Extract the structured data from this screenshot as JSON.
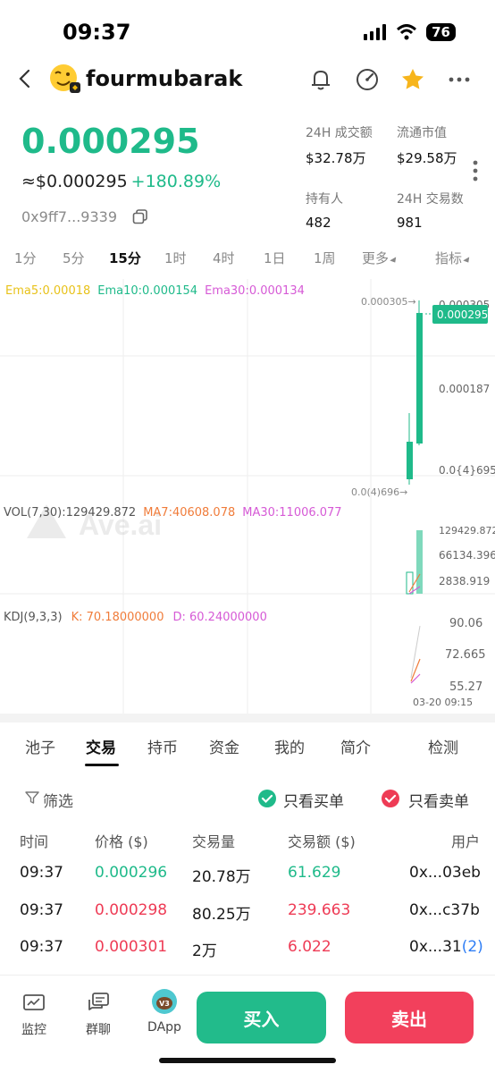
{
  "status": {
    "time": "09:37",
    "battery": "76"
  },
  "header": {
    "token_name": "fourmubarak"
  },
  "price": {
    "main": "0.000295",
    "usd": "≈$0.000295",
    "change": "+180.89%",
    "address": "0x9ff7...9339"
  },
  "stats": [
    {
      "label": "24H 成交额",
      "value": "$32.78万"
    },
    {
      "label": "流通市值",
      "value": "$29.58万"
    },
    {
      "label": "持有人",
      "value": "482"
    },
    {
      "label": "24H 交易数",
      "value": "981"
    }
  ],
  "timeframes": [
    "1分",
    "5分",
    "15分",
    "1时",
    "4时",
    "1日",
    "1周",
    "更多",
    "指标"
  ],
  "chart": {
    "ema5": "Ema5:0.00018",
    "ema10": "Ema10:0.000154",
    "ema30": "Ema30:0.000134",
    "high_label": "0.000305→",
    "low_label": "0.0(4)696→",
    "current_price": "0.000295",
    "y_ticks": [
      "0.000305",
      "0.000187",
      "0.0{4}695"
    ],
    "vol_line": "VOL(7,30):129429.872",
    "vol_ma7": "MA7:40608.078",
    "vol_ma30": "MA30:11006.077",
    "vol_ticks": [
      "129429.872",
      "66134.396",
      "2838.919"
    ],
    "kdj_line": "KDJ(9,3,3)",
    "kdj_k": "K: 70.18000000",
    "kdj_d": "D: 60.24000000",
    "kdj_ticks": [
      "90.06",
      "72.665",
      "55.27"
    ],
    "time_label": "03-20 09:15",
    "watermark": "Ave.ai",
    "colors": {
      "ema5": "#e8c21a",
      "ema10": "#1fba8a",
      "ema30": "#d65ad6",
      "up": "#1fba8a",
      "ma7": "#f07c3a",
      "ma30": "#d65ad6"
    }
  },
  "tabs": [
    "池子",
    "交易",
    "持币",
    "资金",
    "我的",
    "简介",
    "检测"
  ],
  "filter": {
    "label": "筛选",
    "buy_only": "只看买单",
    "sell_only": "只看卖单"
  },
  "table": {
    "headers": [
      "时间",
      "价格 ($)",
      "交易量",
      "交易额 ($)",
      "用户"
    ],
    "rows": [
      {
        "time": "09:37",
        "price": "0.000296",
        "qty": "20.78万",
        "amount": "61.629",
        "user": "0x...03eb",
        "user_extra": "",
        "side": "buy"
      },
      {
        "time": "09:37",
        "price": "0.000298",
        "qty": "80.25万",
        "amount": "239.663",
        "user": "0x...c37b",
        "user_extra": "",
        "side": "sell"
      },
      {
        "time": "09:37",
        "price": "0.000301",
        "qty": "2万",
        "amount": "6.022",
        "user": "0x...31",
        "user_extra": "(2)",
        "side": "sell"
      }
    ]
  },
  "bottom_nav": {
    "monitor": "监控",
    "group_chat": "群聊",
    "dapp": "DApp",
    "dapp_badge": "V3",
    "buy": "买入",
    "sell": "卖出"
  }
}
